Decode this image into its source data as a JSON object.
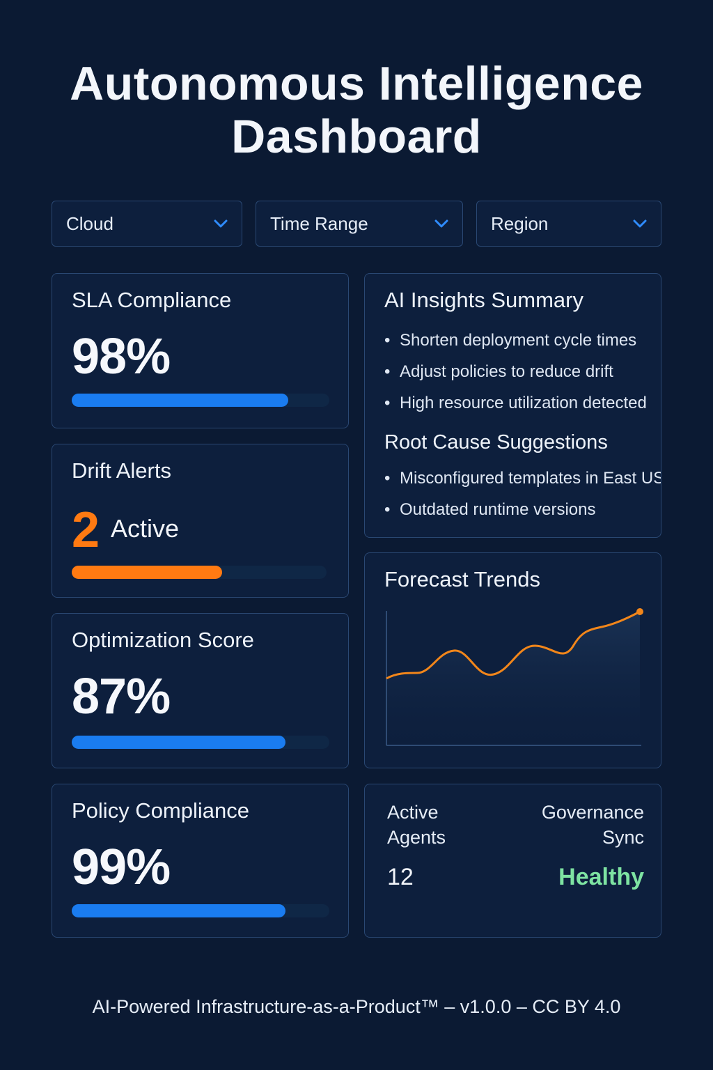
{
  "header": {
    "title_line1": "Autonomous Intelligence",
    "title_line2": "Dashboard"
  },
  "filters": [
    {
      "label": "Cloud",
      "icon": "chevron-down-icon"
    },
    {
      "label": "Time Range",
      "icon": "chevron-down-icon"
    },
    {
      "label": "Region",
      "icon": "chevron-down-icon"
    }
  ],
  "metrics": {
    "sla": {
      "title": "SLA Compliance",
      "value": "98%",
      "progress": 0.84
    },
    "drift": {
      "title": "Drift Alerts",
      "count": "2",
      "status": "Active",
      "progress": 0.59
    },
    "optimization": {
      "title": "Optimization Score",
      "value": "87%",
      "progress": 0.83
    },
    "policy": {
      "title": "Policy Compliance",
      "value": "99%",
      "progress": 0.83
    }
  },
  "insights": {
    "title": "AI Insights Summary",
    "items": [
      "Shorten deployment cycle times",
      "Adjust policies to reduce drift",
      "High resource utilization detected"
    ],
    "root_title": "Root Cause Suggestions",
    "root_items": [
      "Misconfigured templates in East US",
      "Outdated runtime versions"
    ]
  },
  "forecast": {
    "title": "Forecast Trends"
  },
  "status": {
    "agents_label_line1": "Active",
    "agents_label_line2": "Agents",
    "agents_value": "12",
    "gov_label_line1": "Governance",
    "gov_label_line2": "Sync",
    "gov_value": "Healthy"
  },
  "footer": {
    "text": "AI-Powered Infrastructure-as-a-Product™ – v1.0.0 – CC BY 4.0"
  },
  "colors": {
    "background": "#0b1a33",
    "card": "#0d1f3d",
    "border": "#2a4873",
    "accent_blue": "#1a7cf0",
    "accent_orange": "#ff7a12",
    "healthy_green": "#7ee3a2"
  }
}
